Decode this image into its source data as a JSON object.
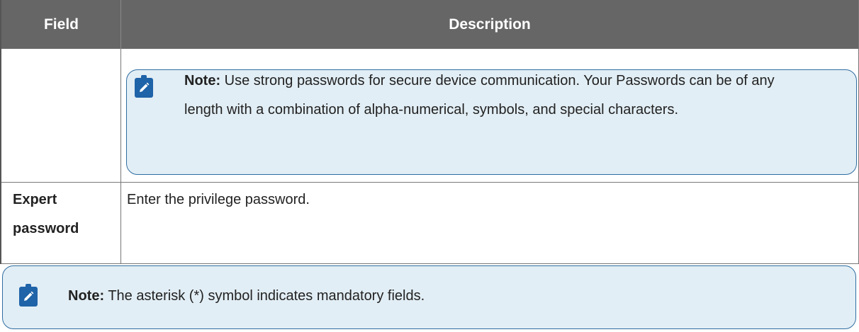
{
  "table": {
    "headers": [
      "Field",
      "Description"
    ],
    "rows": [
      {
        "field": "",
        "note": {
          "label": "Note:",
          "text": "Use strong passwords for secure device communication. Your Passwords can be of any length with a combination of alpha-numerical, symbols, and special characters."
        }
      },
      {
        "field": "Expert password",
        "description": "Enter the privilege password."
      }
    ]
  },
  "footer_note": {
    "label": "Note:",
    "text": "The asterisk (*) symbol indicates mandatory fields."
  },
  "colors": {
    "header_bg": "#666666",
    "note_bg": "#e2eef5",
    "note_border": "#2f6da1",
    "icon": "#1f63a8"
  },
  "icons": [
    "note-pencil-icon"
  ]
}
